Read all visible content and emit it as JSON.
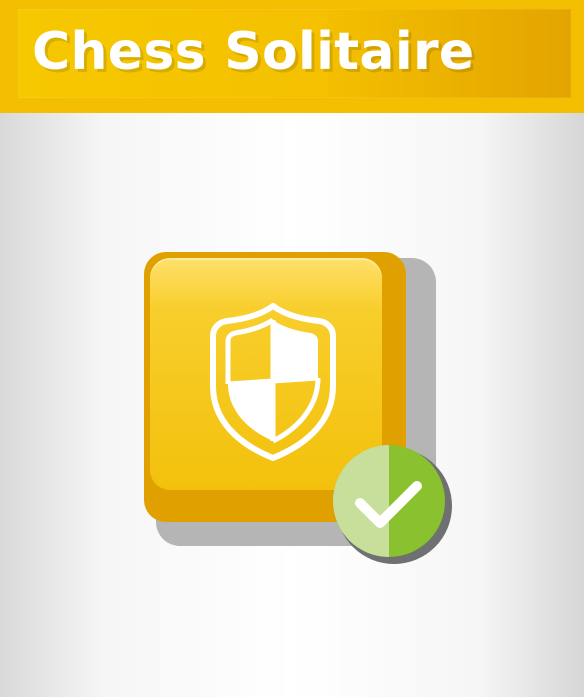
{
  "header": {
    "title": "Chess Solitaire"
  },
  "icon": {
    "shield": "shield-icon",
    "check": "check-icon",
    "colors": {
      "tile": "#f3c10c",
      "shield": "#ffffff",
      "check_bg": "#8ac12f"
    }
  }
}
